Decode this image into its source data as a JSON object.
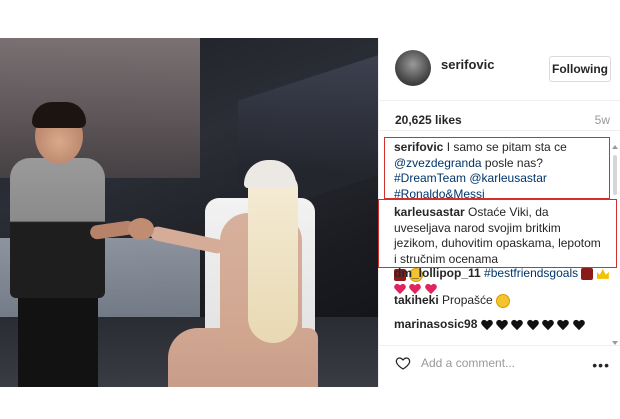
{
  "post": {
    "username": "serifovic",
    "follow_label": "Following",
    "likes": "20,625 likes",
    "time_ago": "5w"
  },
  "comments": [
    {
      "username": "serifovic",
      "text_before": " I samo se pitam sta ce ",
      "mention1": "@zvezdegranda",
      "text_mid": " posle nas? ",
      "hashtag1": "#DreamTeam",
      "mention2": " @karleusastar",
      "hashtag2": "#Ronaldo&Messi"
    },
    {
      "username": "karleusastar",
      "text": " Ostaće Viki, da uveseljava narod svojim britkim jezikom, duhovitim opaskama, lepotom i stručnim ocenama"
    },
    {
      "username": "dm_lollipop_11",
      "hashtag": "#bestfriendsgoals"
    },
    {
      "username": "takiheki",
      "text": " Propašće"
    },
    {
      "username": "marinasosic98",
      "text": ""
    }
  ],
  "comment_input": {
    "placeholder": "Add a comment..."
  },
  "colors": {
    "highlight_border": "#d22f2f",
    "link": "#003569",
    "muted": "#999999"
  },
  "icons": [
    "heart-icon",
    "more-icon"
  ]
}
